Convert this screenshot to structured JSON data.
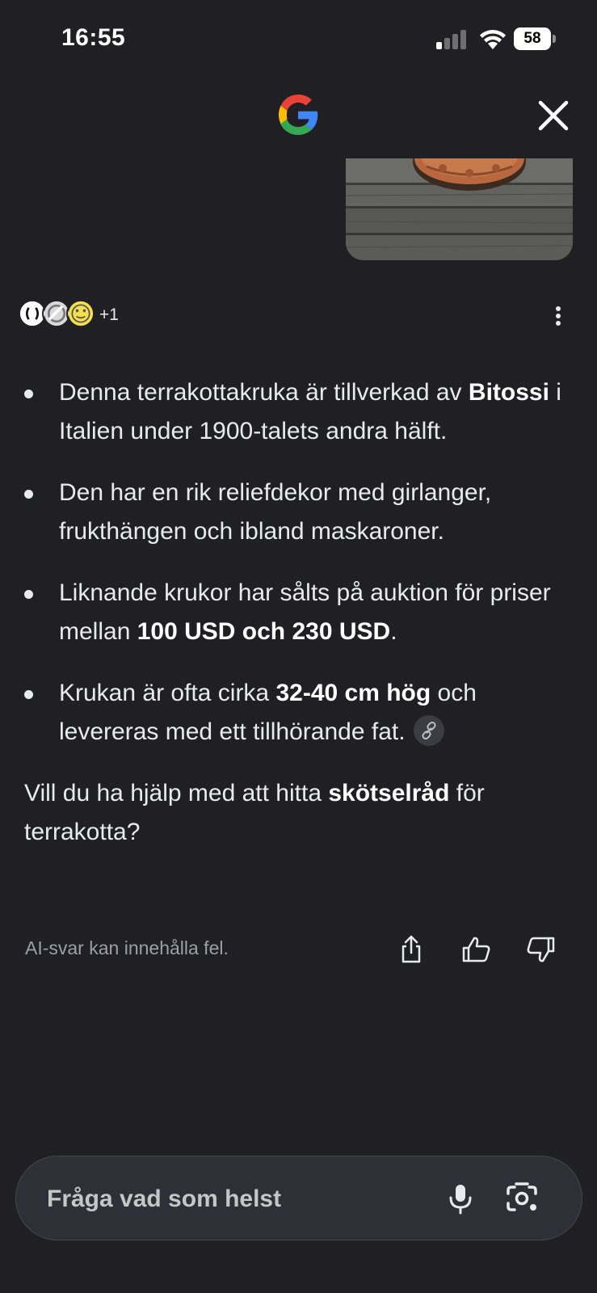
{
  "status_bar": {
    "time": "16:55",
    "battery": "58"
  },
  "header": {
    "logo_icon": "google-g-icon",
    "close_icon": "close-icon"
  },
  "sources": {
    "count_label": "+1"
  },
  "answer": {
    "bullets": [
      {
        "segments": [
          {
            "text": "Denna terrakottakruka är tillverkad av ",
            "bold": false
          },
          {
            "text": "Bitossi",
            "bold": true
          },
          {
            "text": " i Italien under 1900-talets andra hälft.",
            "bold": false
          }
        ]
      },
      {
        "segments": [
          {
            "text": "Den har en rik reliefdekor med girlanger, frukthängen och ibland maskaroner.",
            "bold": false
          }
        ]
      },
      {
        "segments": [
          {
            "text": "Liknande krukor har sålts på auktion för priser mellan ",
            "bold": false
          },
          {
            "text": "100 USD och 230 USD",
            "bold": true
          },
          {
            "text": ".",
            "bold": false
          }
        ]
      },
      {
        "segments": [
          {
            "text": "Krukan är ofta cirka ",
            "bold": false
          },
          {
            "text": "32-40 cm hög",
            "bold": true
          },
          {
            "text": " och levereras med ett tillhörande fat.",
            "bold": false
          }
        ],
        "has_link_chip": true
      }
    ],
    "followup": {
      "before": "Vill du ha hjälp med att hitta ",
      "bold": "skötselråd",
      "after": " för terrakotta?"
    }
  },
  "footer": {
    "disclaimer": "AI-svar kan innehålla fel.",
    "actions": [
      "share-icon",
      "thumbs-up-icon",
      "thumbs-down-icon"
    ]
  },
  "search": {
    "placeholder": "Fråga vad som helst",
    "mic_icon": "mic-icon",
    "lens_icon": "camera-lens-icon"
  },
  "colors": {
    "background": "#1f1f24",
    "text": "#e8eaed",
    "muted": "#9aa0a6",
    "search_bg": "#2e3037"
  }
}
